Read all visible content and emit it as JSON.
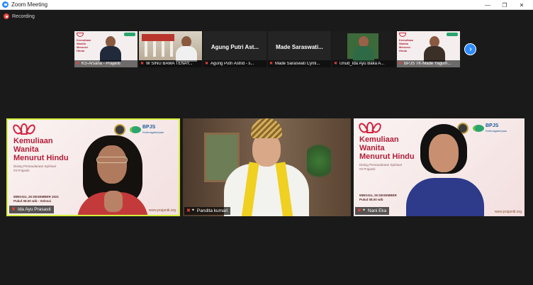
{
  "window": {
    "title": "Zoom Meeting",
    "minimize_glyph": "—",
    "restore_glyph": "❐",
    "close_glyph": "✕"
  },
  "recording": {
    "label": "Recording"
  },
  "strip": {
    "thumbnails": [
      {
        "name": "KS-Arsana - Prajanti",
        "slide_text": "Kemuliaan Wanita Menurut Hindu"
      },
      {
        "name": "W SINU BAWA TENAY..."
      },
      {
        "name": "Agung Putri Astrid - s...",
        "display_name": "Agung Putri Ast..."
      },
      {
        "name": "Made Saraswati Cynti...",
        "display_name": "Made Saraswati..."
      },
      {
        "name": "Unud_Ida Ayu Baka A..."
      },
      {
        "name": "BPJS TK-Made Yagum...",
        "slide_text": "Kemuliaan Wanita Menurut Hindu"
      }
    ],
    "next_glyph": "›"
  },
  "tiles": [
    {
      "name": "Ida Ayu Prasasti",
      "slide": {
        "title_lines": [
          "Kemuliaan",
          "Wanita",
          "Menurut Hindu"
        ],
        "subtitle_lines": [
          "Dialog Persaudaraan Spiritual",
          "#3 Prajaniti"
        ],
        "date_lines": [
          "MINGGU, 26 DESEMBER 2021",
          "Pukul 08.00 wib - Selesai"
        ],
        "brand": "BPJS",
        "brand_sub": "Ketenagakerjaan",
        "site": "www.prajaniti.org"
      }
    },
    {
      "name": "Pandita kumari"
    },
    {
      "name": "Nani Eka",
      "slide": {
        "title_lines": [
          "Kemuliaan",
          "Wanita",
          "Menurut Hindu"
        ],
        "subtitle_lines": [
          "Dialog Persaudaraan Spiritual",
          "#3 Prajaniti"
        ],
        "date_lines": [
          "MINGGU, 26 DESEMBER",
          "Pukul 08.00 wib"
        ],
        "brand": "BPJS",
        "brand_sub": "Ketenagakerjaan",
        "site": "www.prajaniti.org"
      }
    }
  ],
  "colors": {
    "speaker_border": "#d4ef3c",
    "accent": "#2d8cff",
    "slide_title": "#b21f3a",
    "muted": "#e8453c"
  }
}
